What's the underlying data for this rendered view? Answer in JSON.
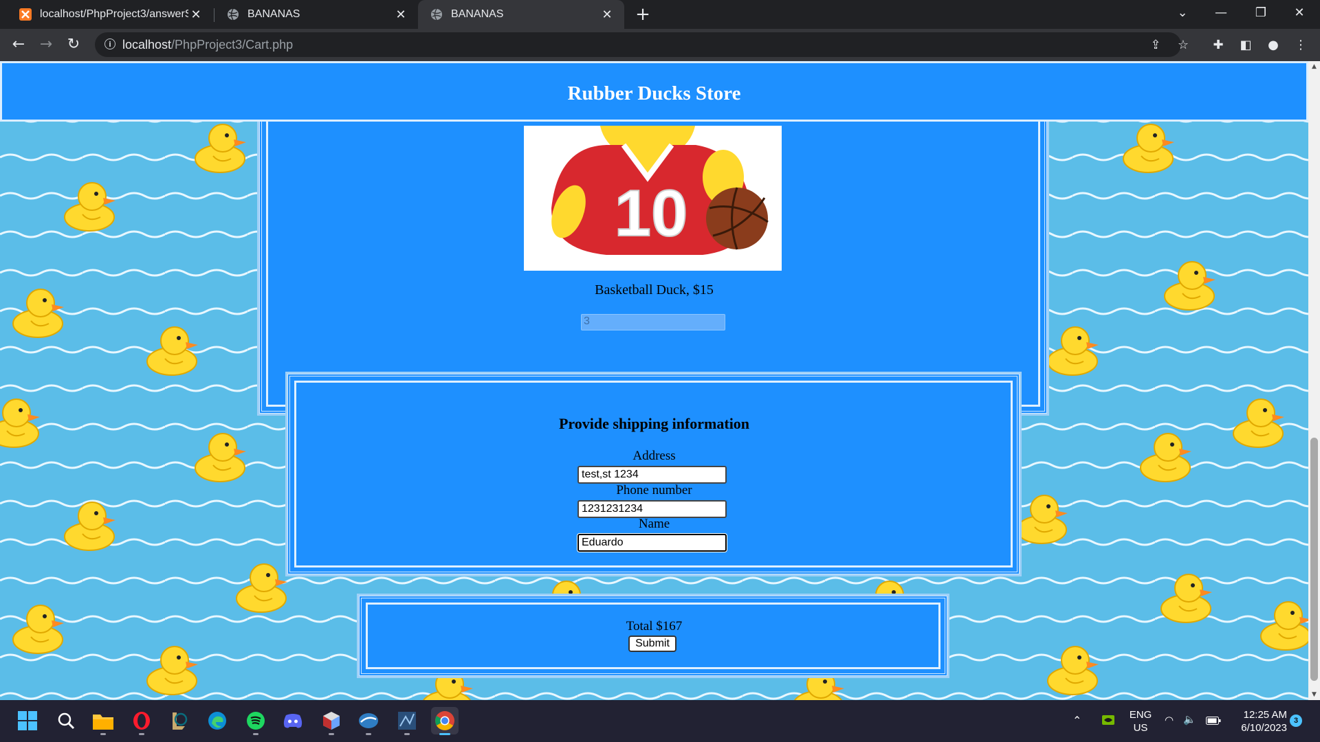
{
  "browser": {
    "tabs": [
      {
        "title": "localhost/PhpProject3/answerSu",
        "active": false
      },
      {
        "title": "BANANAS",
        "active": false
      },
      {
        "title": "BANANAS",
        "active": true
      }
    ],
    "url_host": "localhost",
    "url_path": "/PhpProject3/Cart.php"
  },
  "page": {
    "store_title": "Rubber Ducks Store",
    "product": {
      "caption": "Basketball Duck, $15",
      "quantity": "3",
      "jersey_number": "10"
    },
    "shipping": {
      "title": "Provide shipping information",
      "address_label": "Address",
      "address_value": "test,st 1234",
      "phone_label": "Phone number",
      "phone_value": "1231231234",
      "name_label": "Name",
      "name_value": "Eduardo"
    },
    "total_text": "Total $167",
    "submit_label": "Submit"
  },
  "taskbar": {
    "lang_top": "ENG",
    "lang_bottom": "US",
    "time": "12:25 AM",
    "date": "6/10/2023",
    "notification_count": "3"
  },
  "colors": {
    "panel_blue": "#1e90ff",
    "water_blue": "#5bbde8",
    "duck_yellow": "#ffd92e"
  }
}
